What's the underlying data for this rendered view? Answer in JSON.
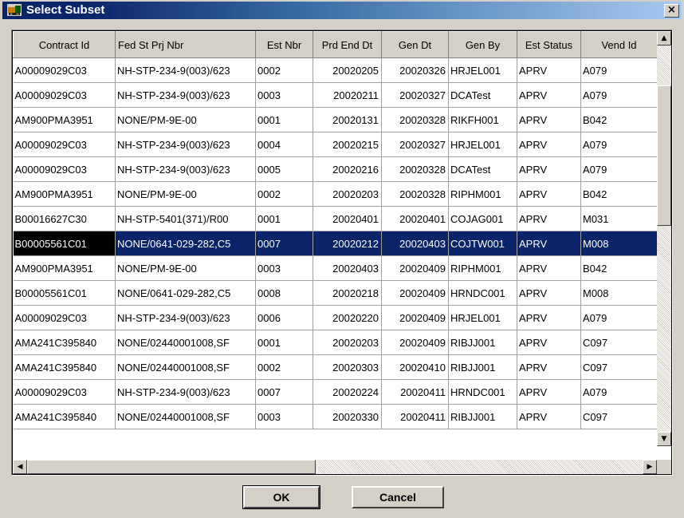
{
  "window": {
    "title": "Select Subset",
    "close_symbol": "×"
  },
  "grid": {
    "columns": [
      "Contract Id",
      "Fed St Prj Nbr",
      "Est Nbr",
      "Prd End Dt",
      "Gen Dt",
      "Gen By",
      "Est Status",
      "Vend Id"
    ],
    "rows": [
      [
        "A00009029C03",
        "NH-STP-234-9(003)/623",
        "0002",
        "20020205",
        "20020326",
        "HRJEL001",
        "APRV",
        "A079"
      ],
      [
        "A00009029C03",
        "NH-STP-234-9(003)/623",
        "0003",
        "20020211",
        "20020327",
        "DCATest",
        "APRV",
        "A079"
      ],
      [
        "AM900PMA3951",
        "NONE/PM-9E-00",
        "0001",
        "20020131",
        "20020328",
        "RIKFH001",
        "APRV",
        "B042"
      ],
      [
        "A00009029C03",
        "NH-STP-234-9(003)/623",
        "0004",
        "20020215",
        "20020327",
        "HRJEL001",
        "APRV",
        "A079"
      ],
      [
        "A00009029C03",
        "NH-STP-234-9(003)/623",
        "0005",
        "20020216",
        "20020328",
        "DCATest",
        "APRV",
        "A079"
      ],
      [
        "AM900PMA3951",
        "NONE/PM-9E-00",
        "0002",
        "20020203",
        "20020328",
        "RIPHM001",
        "APRV",
        "B042"
      ],
      [
        "B00016627C30",
        "NH-STP-5401(371)/R00",
        "0001",
        "20020401",
        "20020401",
        "COJAG001",
        "APRV",
        "M031"
      ],
      [
        "B00005561C01",
        "NONE/0641-029-282,C5",
        "0007",
        "20020212",
        "20020403",
        "COJTW001",
        "APRV",
        "M008"
      ],
      [
        "AM900PMA3951",
        "NONE/PM-9E-00",
        "0003",
        "20020403",
        "20020409",
        "RIPHM001",
        "APRV",
        "B042"
      ],
      [
        "B00005561C01",
        "NONE/0641-029-282,C5",
        "0008",
        "20020218",
        "20020409",
        "HRNDC001",
        "APRV",
        "M008"
      ],
      [
        "A00009029C03",
        "NH-STP-234-9(003)/623",
        "0006",
        "20020220",
        "20020409",
        "HRJEL001",
        "APRV",
        "A079"
      ],
      [
        "AMA241C395840",
        "NONE/02440001008,SF",
        "0001",
        "20020203",
        "20020409",
        "RIBJJ001",
        "APRV",
        "C097"
      ],
      [
        "AMA241C395840",
        "NONE/02440001008,SF",
        "0002",
        "20020303",
        "20020410",
        "RIBJJ001",
        "APRV",
        "C097"
      ],
      [
        "A00009029C03",
        "NH-STP-234-9(003)/623",
        "0007",
        "20020224",
        "20020411",
        "HRNDC001",
        "APRV",
        "A079"
      ],
      [
        "AMA241C395840",
        "NONE/02440001008,SF",
        "0003",
        "20020330",
        "20020411",
        "RIBJJ001",
        "APRV",
        "C097"
      ]
    ],
    "selected_row": 7
  },
  "buttons": {
    "ok": "OK",
    "cancel": "Cancel"
  },
  "scroll": {
    "up_glyph": "▲",
    "down_glyph": "▼",
    "left_glyph": "◀",
    "right_glyph": "▶"
  }
}
